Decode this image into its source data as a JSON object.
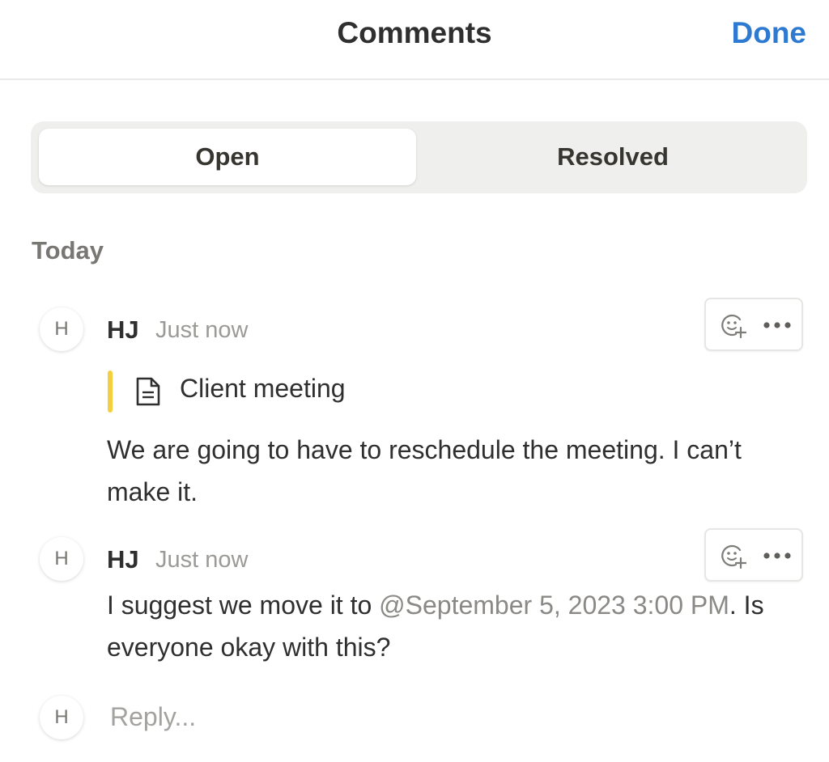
{
  "header": {
    "title": "Comments",
    "done_label": "Done"
  },
  "tabs": [
    {
      "label": "Open",
      "active": true
    },
    {
      "label": "Resolved",
      "active": false
    }
  ],
  "section": {
    "label": "Today"
  },
  "comments": [
    {
      "avatar_initial": "H",
      "author": "HJ",
      "timestamp": "Just now",
      "quote": {
        "icon": "document-icon",
        "text": "Client meeting"
      },
      "body": "We are going to have to reschedule the meeting. I can’t make it.",
      "actions": [
        "add-reaction-icon",
        "more-icon"
      ]
    },
    {
      "avatar_initial": "H",
      "author": "HJ",
      "timestamp": "Just now",
      "body_before": "I suggest we move it to ",
      "mention": "@September 5, 2023 3:00 PM",
      "body_after": ". Is everyone okay with this?",
      "actions": [
        "add-reaction-icon",
        "more-icon"
      ]
    }
  ],
  "reply": {
    "avatar_initial": "H",
    "placeholder": "Reply..."
  },
  "colors": {
    "accent": "#2e7ad1",
    "quote_bar": "#f4d03f",
    "segmented_bg": "#efefee",
    "muted_text": "#9b9a97"
  }
}
